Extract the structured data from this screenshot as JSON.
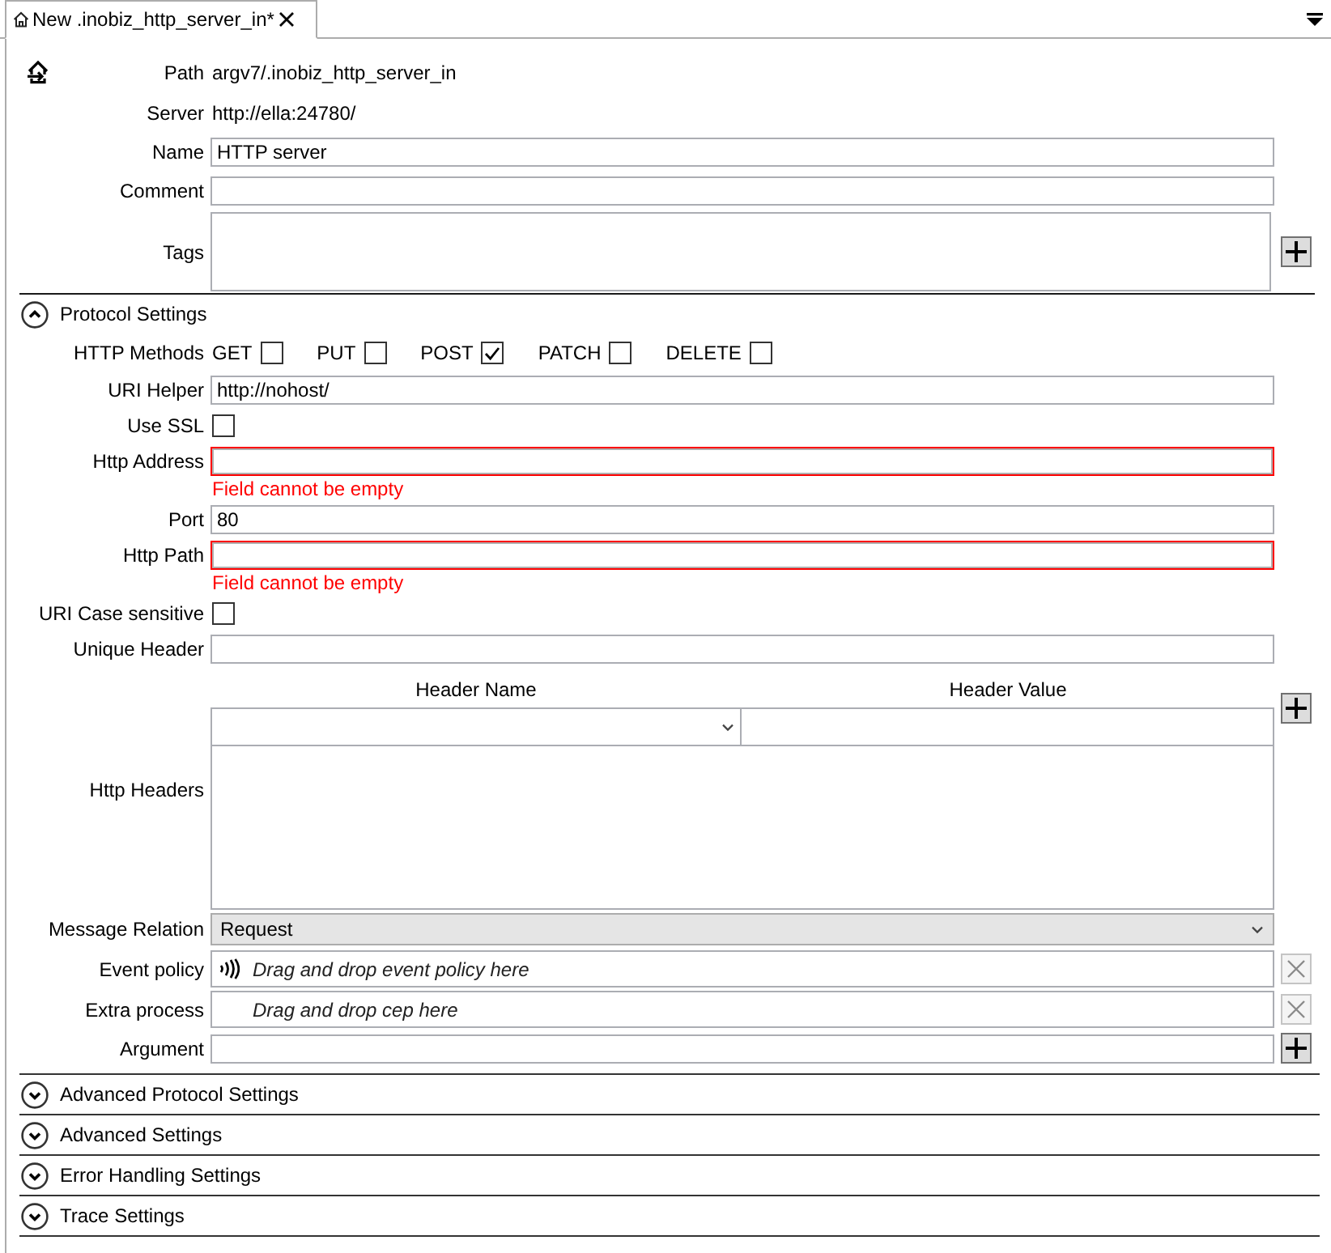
{
  "tab": {
    "title": "New .inobiz_http_server_in*",
    "selected": true
  },
  "info": [
    {
      "label": "Path",
      "value": "argv7/.inobiz_http_server_in"
    },
    {
      "label": "Server",
      "value": "http://ella:24780/"
    }
  ],
  "general": [
    {
      "kind": "input",
      "label": "Name",
      "value": "HTTP server",
      "invalid": false
    },
    {
      "kind": "input",
      "label": "Comment",
      "invalid": false
    },
    {
      "kind": "tags",
      "label": "Tags"
    }
  ],
  "sections": [
    {
      "title": "Protocol Settings",
      "expanded": true,
      "rows": [
        {
          "kind": "methods",
          "label": "HTTP Methods",
          "options": [
            {
              "label": "GET",
              "checked": false
            },
            {
              "label": "PUT",
              "checked": false
            },
            {
              "label": "POST",
              "checked": true
            },
            {
              "label": "PATCH",
              "checked": false
            },
            {
              "label": "DELETE",
              "checked": false
            }
          ]
        },
        {
          "kind": "input",
          "label": "URI Helper",
          "value": "http://nohost/",
          "invalid": false
        },
        {
          "kind": "checkbox",
          "label": "Use SSL",
          "checked": false
        },
        {
          "kind": "input",
          "label": "Http Address",
          "invalid": true,
          "error": "Field cannot be empty"
        },
        {
          "kind": "input",
          "label": "Port",
          "value": "80",
          "invalid": false
        },
        {
          "kind": "input",
          "label": "Http Path",
          "invalid": true,
          "error": "Field cannot be empty"
        },
        {
          "kind": "checkbox",
          "label": "URI Case sensitive",
          "checked": false
        },
        {
          "kind": "input",
          "label": "Unique Header",
          "invalid": false
        },
        {
          "kind": "headers",
          "label": "Http Headers",
          "columns": [
            "Header Name",
            "Header Value"
          ]
        },
        {
          "kind": "select",
          "label": "Message Relation",
          "value": "Request"
        },
        {
          "kind": "drop",
          "label": "Event policy",
          "placeholder": "Drag and drop event policy here",
          "icon": true,
          "clear_disabled": true
        },
        {
          "kind": "drop",
          "label": "Extra process",
          "placeholder": "Drag and drop cep here",
          "icon": false,
          "clear_disabled": true
        },
        {
          "kind": "argument",
          "label": "Argument"
        }
      ]
    },
    {
      "title": "Advanced Protocol Settings",
      "expanded": false
    },
    {
      "title": "Advanced Settings",
      "expanded": false
    },
    {
      "title": "Error Handling Settings",
      "expanded": false
    },
    {
      "title": "Trace Settings",
      "expanded": false
    }
  ]
}
